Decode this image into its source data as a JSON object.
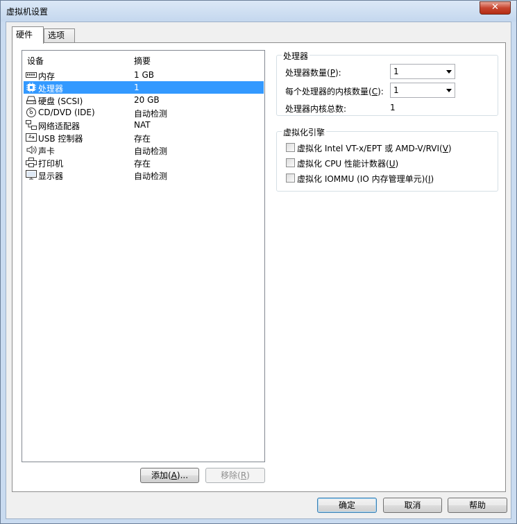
{
  "window": {
    "title": "虚拟机设置",
    "close_symbol": "✕"
  },
  "tabs": [
    {
      "label": "硬件"
    },
    {
      "label": "选项"
    }
  ],
  "device_list": {
    "columns": {
      "device": "设备",
      "summary": "摘要"
    },
    "rows": [
      {
        "name": "内存",
        "summary": "1 GB",
        "icon": "memory-icon"
      },
      {
        "name": "处理器",
        "summary": "1",
        "icon": "processor-icon"
      },
      {
        "name": "硬盘 (SCSI)",
        "summary": "20 GB",
        "icon": "hard-disk-icon"
      },
      {
        "name": "CD/DVD (IDE)",
        "summary": "自动检测",
        "icon": "cd-dvd-icon"
      },
      {
        "name": "网络适配器",
        "summary": "NAT",
        "icon": "network-adapter-icon"
      },
      {
        "name": "USB 控制器",
        "summary": "存在",
        "icon": "usb-icon"
      },
      {
        "name": "声卡",
        "summary": "自动检测",
        "icon": "sound-card-icon"
      },
      {
        "name": "打印机",
        "summary": "存在",
        "icon": "printer-icon"
      },
      {
        "name": "显示器",
        "summary": "自动检测",
        "icon": "display-icon"
      }
    ],
    "selected_index": 1,
    "add_button": {
      "text": "添加(",
      "key": "A",
      "suffix": ")..."
    },
    "remove_button": {
      "text": "移除(",
      "key": "R",
      "suffix": ")"
    }
  },
  "processor": {
    "group_title": "处理器",
    "count_label": {
      "text": "处理器数量(",
      "key": "P",
      "suffix": "):"
    },
    "count_value": "1",
    "cores_label": {
      "text": "每个处理器的内核数量(",
      "key": "C",
      "suffix": "):"
    },
    "cores_value": "1",
    "total_label": "处理器内核总数:",
    "total_value": "1"
  },
  "virtualization": {
    "group_title": "虚拟化引擎",
    "options": [
      {
        "text": "虚拟化 Intel VT-x/EPT 或 AMD-V/RVI(",
        "key": "V",
        "suffix": ")",
        "checked": false
      },
      {
        "text": "虚拟化 CPU 性能计数器(",
        "key": "U",
        "suffix": ")",
        "checked": false
      },
      {
        "text": "虚拟化 IOMMU (IO 内存管理单元)(",
        "key": "I",
        "suffix": ")",
        "checked": false
      }
    ]
  },
  "footer": {
    "ok": "确定",
    "cancel": "取消",
    "help": "帮助"
  },
  "colors": {
    "selection": "#3399ff",
    "title_bar": "#c9dbf0",
    "close_button": "#c7452f"
  }
}
